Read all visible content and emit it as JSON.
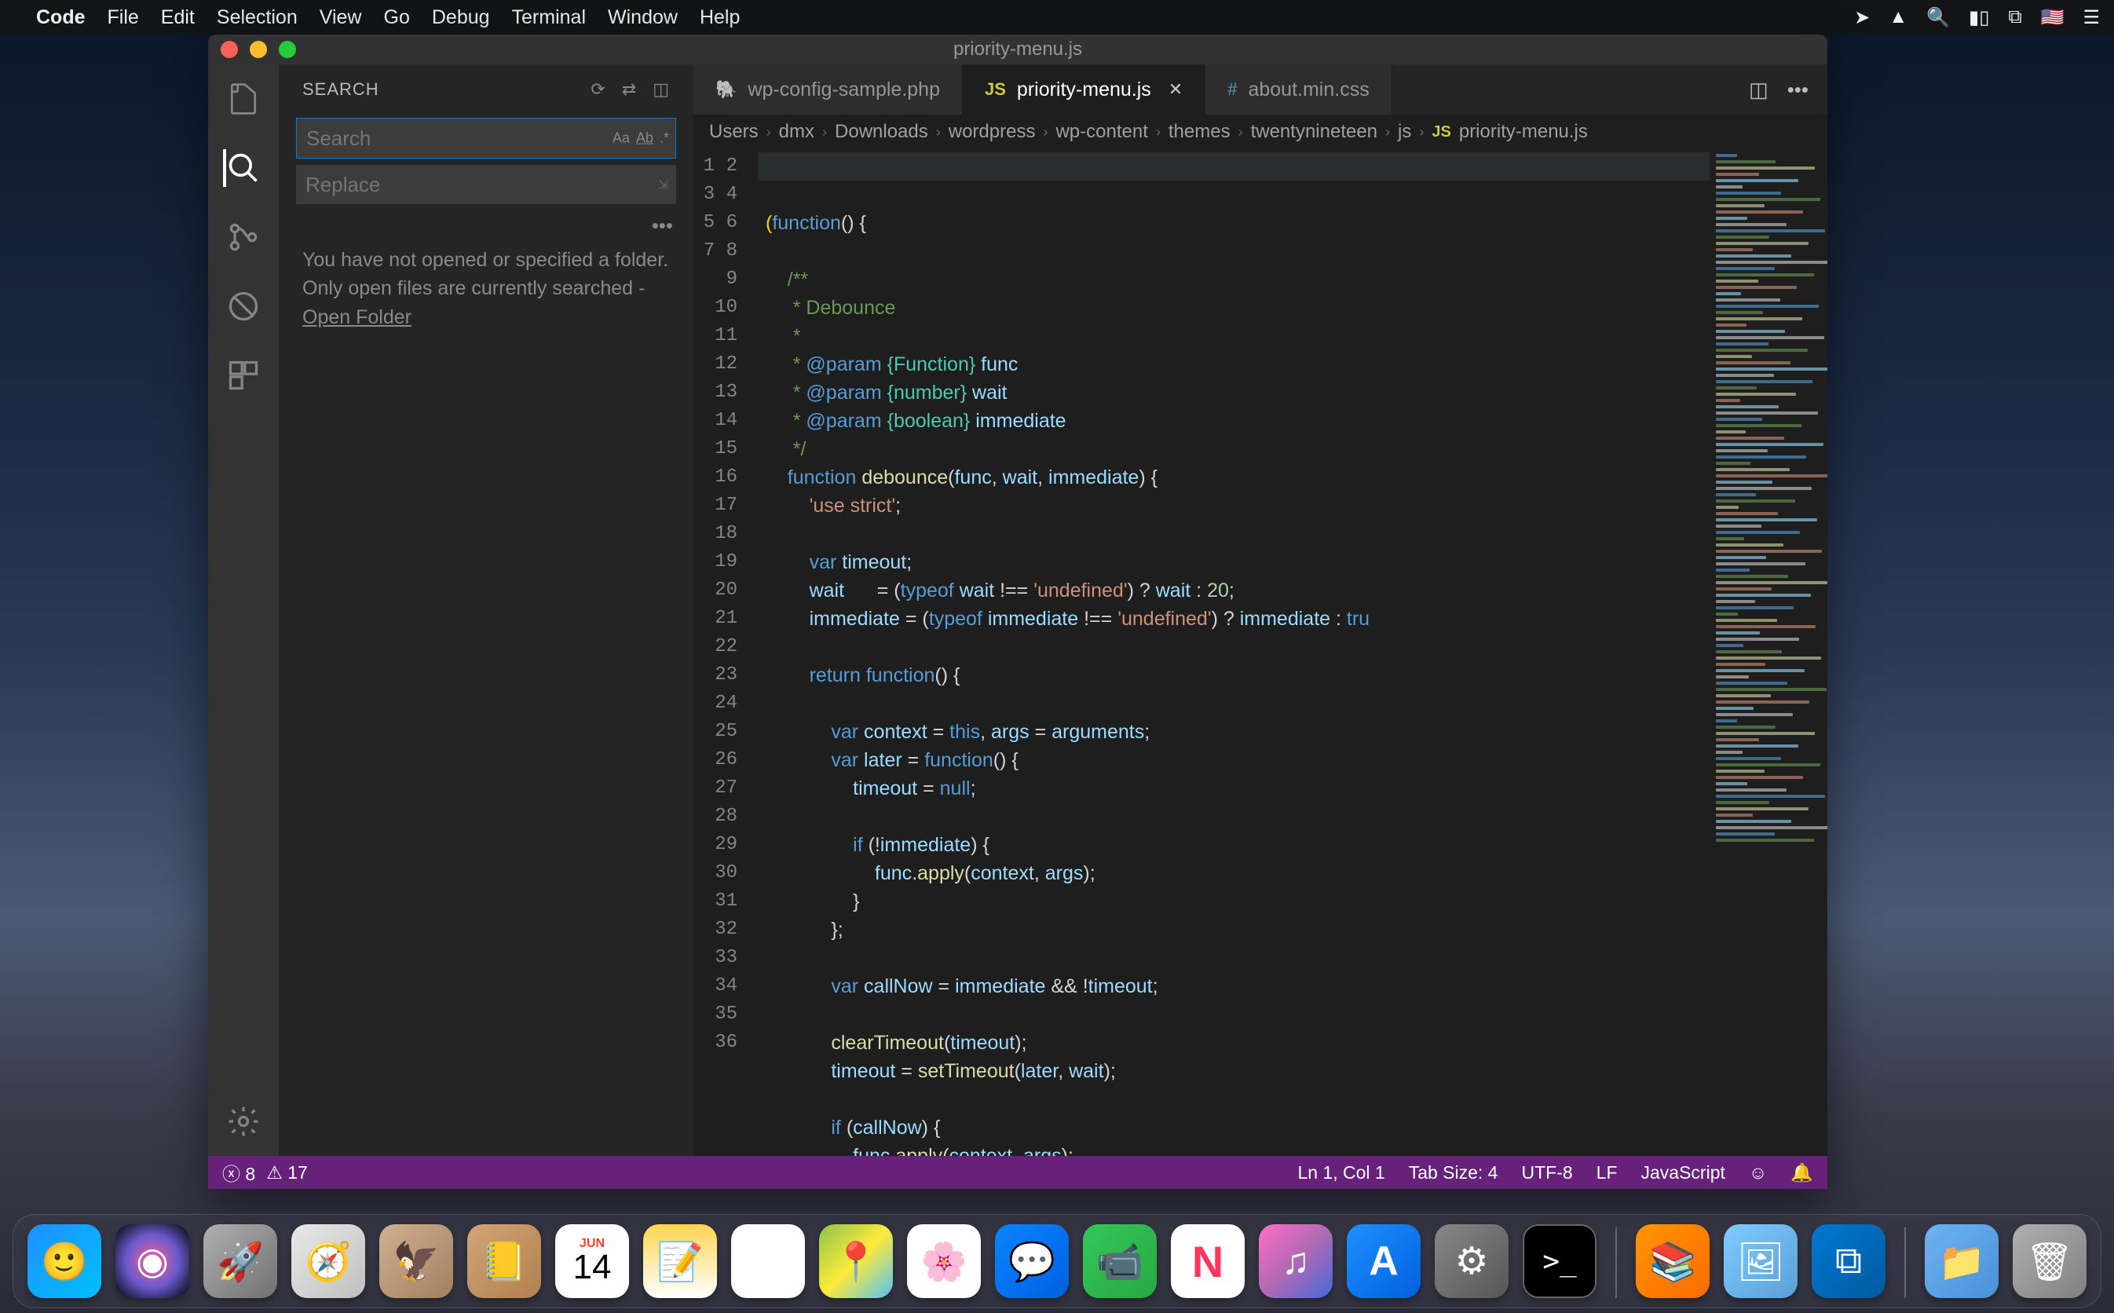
{
  "mac_menu": {
    "app": "Code",
    "items": [
      "File",
      "Edit",
      "Selection",
      "View",
      "Go",
      "Debug",
      "Terminal",
      "Window",
      "Help"
    ]
  },
  "window": {
    "title": "priority-menu.js"
  },
  "sidebar": {
    "title": "SEARCH",
    "search_placeholder": "Search",
    "replace_placeholder": "Replace",
    "message_line1": "You have not opened or specified a folder.",
    "message_line2": "Only open files are currently searched -",
    "open_folder_link": "Open Folder"
  },
  "tabs": [
    {
      "icon": "php",
      "label": "wp-config-sample.php",
      "active": false
    },
    {
      "icon": "js",
      "label": "priority-menu.js",
      "active": true,
      "closeable": true
    },
    {
      "icon": "css",
      "label": "about.min.css",
      "active": false
    }
  ],
  "breadcrumbs": [
    "Users",
    "dmx",
    "Downloads",
    "wordpress",
    "wp-content",
    "themes",
    "twentynineteen",
    "js"
  ],
  "breadcrumb_file": "priority-menu.js",
  "editor": {
    "first_line": 1,
    "last_line": 36
  },
  "status": {
    "errors": "8",
    "warnings": "17",
    "cursor": "Ln 1, Col 1",
    "tab_size": "Tab Size: 4",
    "encoding": "UTF-8",
    "eol": "LF",
    "language": "JavaScript"
  },
  "dock_items": [
    {
      "name": "finder",
      "bg": "linear-gradient(135deg,#1e90ff,#00bfff)",
      "glyph": "🙂"
    },
    {
      "name": "siri",
      "bg": "radial-gradient(circle,#ff5e9c,#6a5acd,#000)",
      "glyph": "◉"
    },
    {
      "name": "launchpad",
      "bg": "linear-gradient(135deg,#b0b0b0,#707070)",
      "glyph": "🚀"
    },
    {
      "name": "safari",
      "bg": "linear-gradient(135deg,#e8e8e8,#c0c0c0)",
      "glyph": "🧭"
    },
    {
      "name": "mail",
      "bg": "linear-gradient(135deg,#d0b090,#a08060)",
      "glyph": "🦅"
    },
    {
      "name": "contacts",
      "bg": "linear-gradient(135deg,#d4a574,#b08050)",
      "glyph": "📒"
    },
    {
      "name": "calendar",
      "bg": "#fff",
      "glyph": "14"
    },
    {
      "name": "notes",
      "bg": "linear-gradient(180deg,#ffd54f,#fff)",
      "glyph": "📝"
    },
    {
      "name": "reminders",
      "bg": "#fff",
      "glyph": "☰"
    },
    {
      "name": "maps",
      "bg": "linear-gradient(135deg,#8bc34a,#ffeb3b,#4fc3f7)",
      "glyph": "📍"
    },
    {
      "name": "photos",
      "bg": "#fff",
      "glyph": "🌸"
    },
    {
      "name": "messages",
      "bg": "linear-gradient(135deg,#0a84ff,#0060df)",
      "glyph": "💬"
    },
    {
      "name": "facetime",
      "bg": "linear-gradient(135deg,#34c759,#28a745)",
      "glyph": "📹"
    },
    {
      "name": "news",
      "bg": "#fff",
      "glyph": "N"
    },
    {
      "name": "itunes",
      "bg": "linear-gradient(135deg,#ff6ec7,#b06ab3,#4568dc)",
      "glyph": "♫"
    },
    {
      "name": "appstore",
      "bg": "linear-gradient(135deg,#1e90ff,#0060df)",
      "glyph": "A"
    },
    {
      "name": "preferences",
      "bg": "linear-gradient(135deg,#888,#555)",
      "glyph": "⚙"
    },
    {
      "name": "terminal",
      "bg": "#000",
      "glyph": ">_"
    },
    {
      "name": "books",
      "bg": "linear-gradient(135deg,#ff9500,#ff6a00)",
      "glyph": "📚"
    },
    {
      "name": "preview",
      "bg": "linear-gradient(135deg,#7ecbff,#5aa0d8)",
      "glyph": "🖼"
    },
    {
      "name": "vscode",
      "bg": "linear-gradient(135deg,#0078d4,#005a9e)",
      "glyph": "⧉"
    },
    {
      "name": "downloads",
      "bg": "linear-gradient(135deg,#6db3f2,#4a90d9)",
      "glyph": "📁"
    },
    {
      "name": "trash",
      "bg": "linear-gradient(135deg,#b0b0b0,#808080)",
      "glyph": "🗑"
    }
  ]
}
